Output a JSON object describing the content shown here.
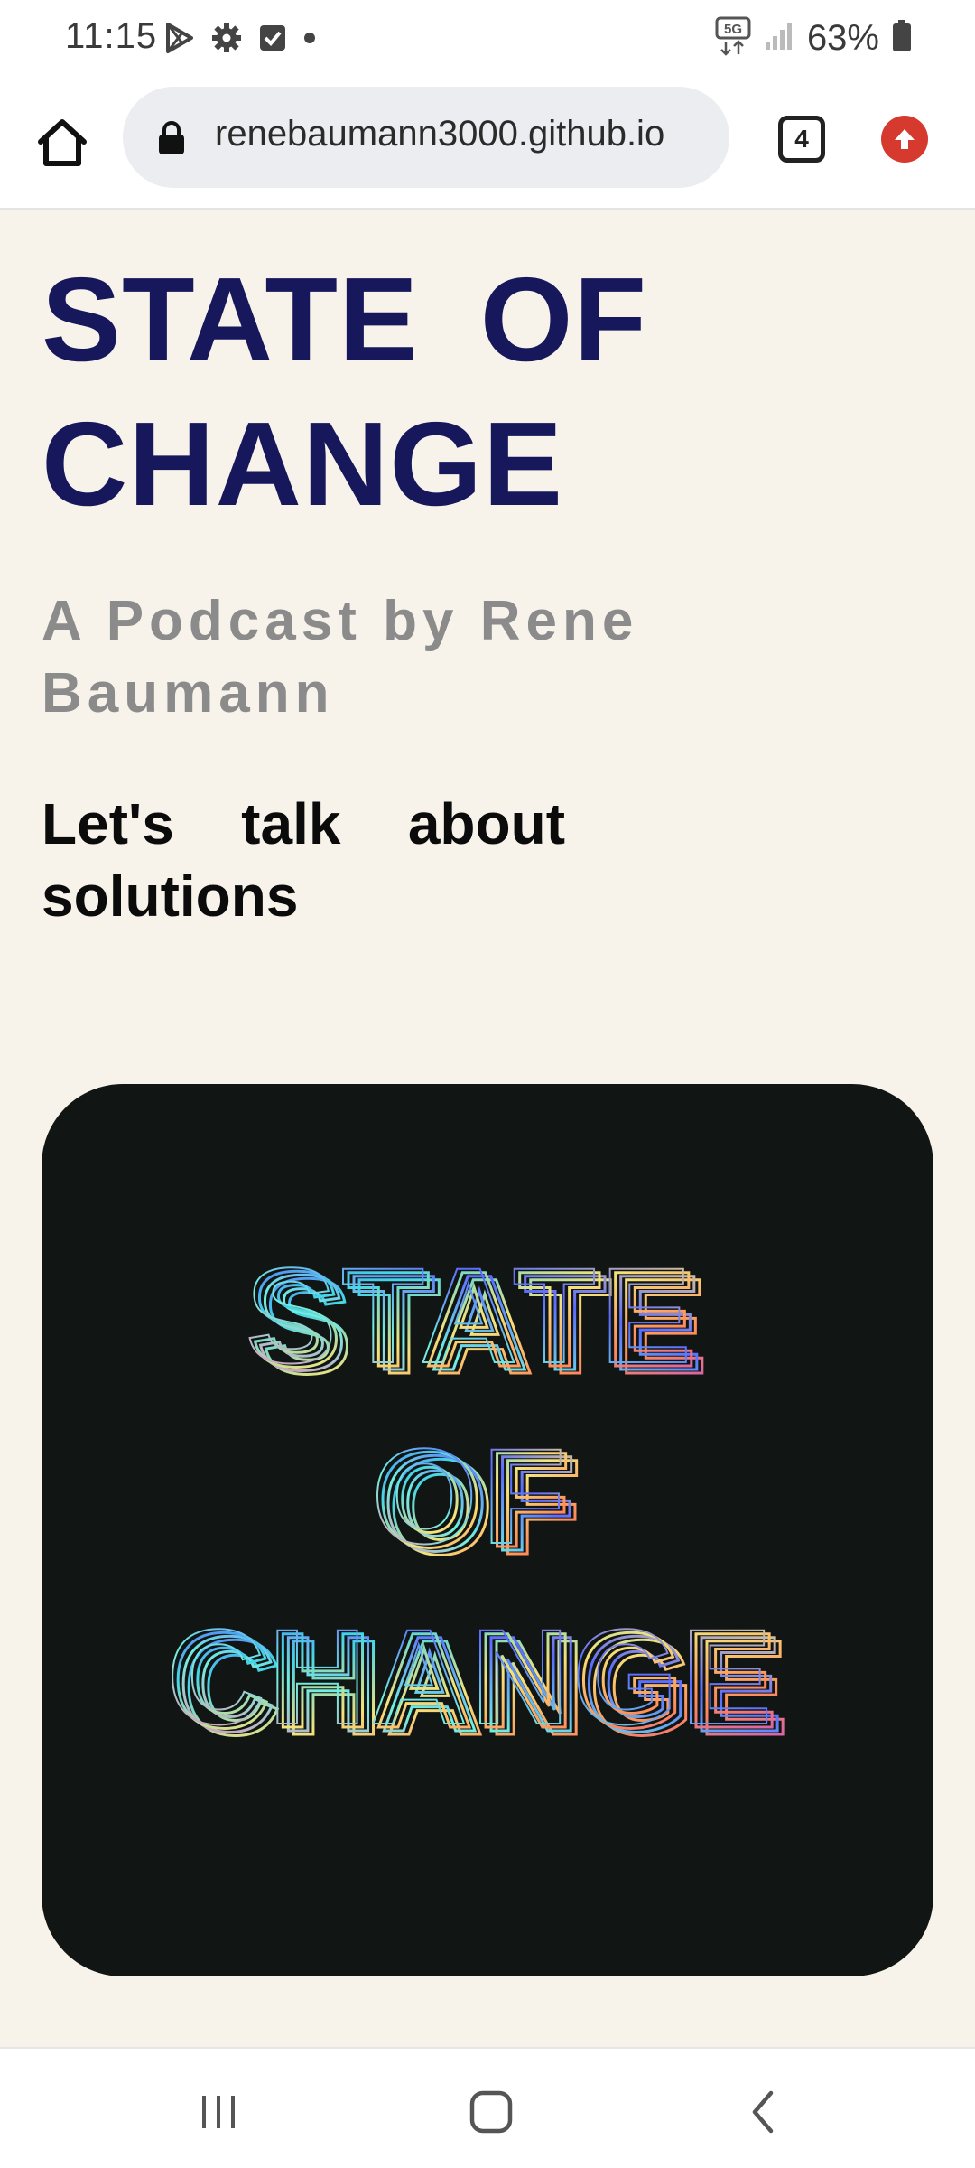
{
  "status_bar": {
    "time": "11:15",
    "left_icons": [
      "play-store-icon",
      "gear-icon",
      "checkbox-icon",
      "dot-icon"
    ],
    "network": "5G",
    "battery": "63%"
  },
  "browser": {
    "url": "renebaumann3000.github.io",
    "tab_count": "4",
    "update_color": "#d63a2f"
  },
  "page": {
    "title": "STATE OF CHANGE",
    "subtitle": "A Podcast by Rene Baumann",
    "tagline": "Let's talk about solutions",
    "cover_art_text": [
      "STATE",
      "OF",
      "CHANGE"
    ],
    "colors": {
      "background": "#f8f3ea",
      "title": "#17175c",
      "subtitle": "#8b8b8b",
      "cover_background": "#111513"
    }
  },
  "nav_bar": {
    "buttons": [
      "recent-apps-icon",
      "home-icon",
      "back-icon"
    ]
  }
}
